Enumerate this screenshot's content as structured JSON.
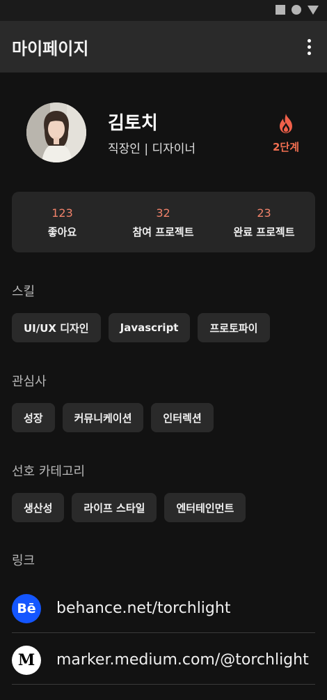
{
  "app_bar": {
    "title": "마이페이지",
    "menu_icon": "more-vertical-icon"
  },
  "profile": {
    "name": "김토치",
    "role": "직장인 | 디자이너",
    "level_icon": "flame-icon",
    "level": "2단계",
    "accent_color": "#f06e50"
  },
  "stats": [
    {
      "value": "123",
      "label": "좋아요"
    },
    {
      "value": "32",
      "label": "참여 프로젝트"
    },
    {
      "value": "23",
      "label": "완료 프로젝트"
    }
  ],
  "skills": {
    "title": "스킬",
    "items": [
      "UI/UX 디자인",
      "Javascript",
      "프로토파이"
    ]
  },
  "interests": {
    "title": "관심사",
    "items": [
      "성장",
      "커뮤니케이션",
      "인터렉션"
    ]
  },
  "categories": {
    "title": "선호 카테고리",
    "items": [
      "생산성",
      "라이프 스타일",
      "엔터테인먼트"
    ]
  },
  "links": {
    "title": "링크",
    "items": [
      {
        "icon": "behance-icon",
        "glyph": "Bē",
        "url": "behance.net/torchlight",
        "color": "#1456ff"
      },
      {
        "icon": "medium-icon",
        "glyph": "M",
        "url": "marker.medium.com/@torchlight",
        "color": "#ffffff"
      }
    ]
  }
}
